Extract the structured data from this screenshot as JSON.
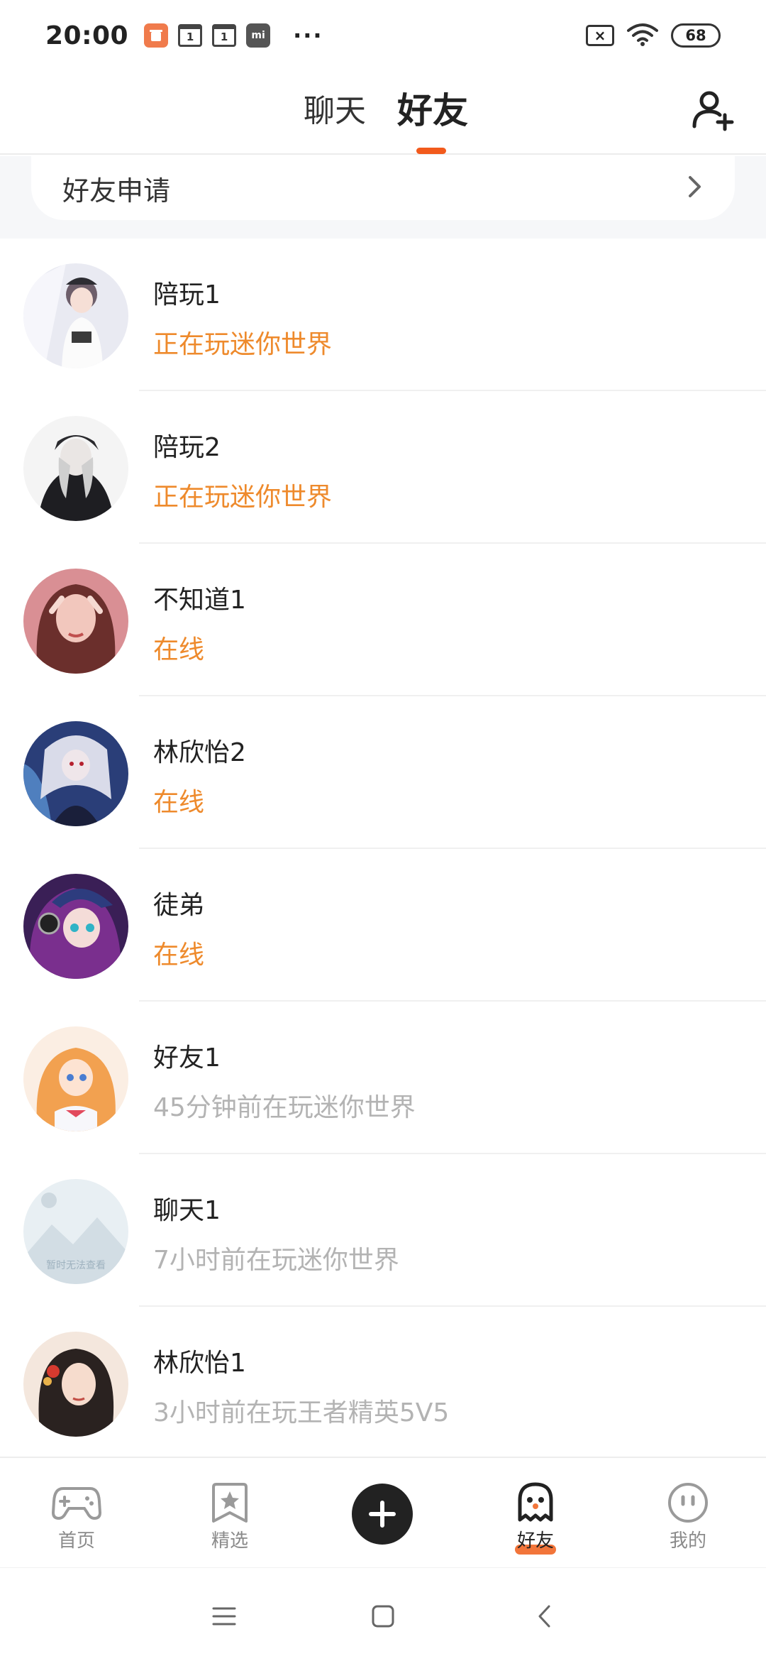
{
  "status_bar": {
    "time": "20:00",
    "app_badge": "mi",
    "calendar_1": "1",
    "calendar_2": "1",
    "more": "···",
    "battery": "68",
    "no_sim": "×"
  },
  "header": {
    "tabs": [
      {
        "label": "聊天",
        "active": false
      },
      {
        "label": "好友",
        "active": true
      }
    ],
    "accent_color": "#f25a1c"
  },
  "friend_request": {
    "label": "好友申请"
  },
  "friends": [
    {
      "name": "陪玩1",
      "status": "正在玩迷你世界",
      "status_kind": "active"
    },
    {
      "name": "陪玩2",
      "status": "正在玩迷你世界",
      "status_kind": "active"
    },
    {
      "name": "不知道1",
      "status": "在线",
      "status_kind": "active"
    },
    {
      "name": "林欣怡2",
      "status": "在线",
      "status_kind": "active"
    },
    {
      "name": "徒弟",
      "status": "在线",
      "status_kind": "active"
    },
    {
      "name": "好友1",
      "status": "45分钟前在玩迷你世界",
      "status_kind": "idle"
    },
    {
      "name": "聊天1",
      "status": "7小时前在玩迷你世界",
      "status_kind": "idle",
      "avatar_placeholder": "暂时无法查看"
    },
    {
      "name": "林欣怡1",
      "status": "3小时前在玩王者精英5V5",
      "status_kind": "idle"
    }
  ],
  "tabbar": {
    "home": "首页",
    "featured": "精选",
    "friends": "好友",
    "me": "我的"
  },
  "colors": {
    "active_status": "#ee8a2c",
    "idle_status": "#b3b3b3"
  }
}
